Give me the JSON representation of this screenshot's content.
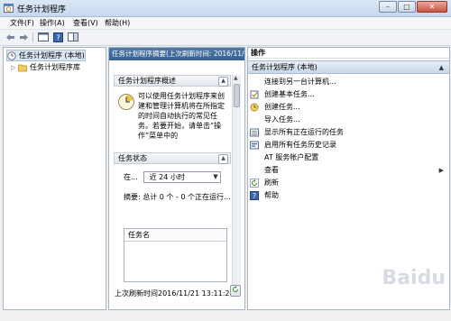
{
  "window": {
    "title": "任务计划程序",
    "controls": {
      "minimize": "–",
      "maximize": "□",
      "close": "✕"
    }
  },
  "menu": [
    "文件(F)",
    "操作(A)",
    "查看(V)",
    "帮助(H)"
  ],
  "tree": {
    "root": "任务计划程序 (本地)",
    "child": "任务计划程序库"
  },
  "middle": {
    "header": "任务计划程序摘要(上次刷新时间: 2016/11/",
    "overview": {
      "title": "任务计划程序概述",
      "text": "可以使用任务计划程序来创建和管理计算机将在所指定的时间自动执行的常见任务。若要开始，请单击“操作”菜单中的"
    },
    "status": {
      "title": "任务状态",
      "label": "在...",
      "select": "近 24 小时",
      "summary": "摘要: 总计 0 个 - 0 个正在运行..."
    },
    "table": {
      "column": "任务名"
    },
    "footer": "上次刷新时间2016/11/21 13:11:24"
  },
  "actions": {
    "title": "操作",
    "group": "任务计划程序 (本地)",
    "items": [
      {
        "label": "连接到另一台计算机...",
        "icon": "none"
      },
      {
        "label": "创建基本任务...",
        "icon": "wizard-icon"
      },
      {
        "label": "创建任务...",
        "icon": "task-icon"
      },
      {
        "label": "导入任务...",
        "icon": "none"
      },
      {
        "label": "显示所有正在运行的任务",
        "icon": "list-icon"
      },
      {
        "label": "启用所有任务历史记录",
        "icon": "history-icon"
      },
      {
        "label": "AT 服务帐户配置",
        "icon": "none"
      },
      {
        "label": "查看",
        "icon": "none",
        "submenu": true
      },
      {
        "label": "刷新",
        "icon": "refresh-icon"
      },
      {
        "label": "帮助",
        "icon": "help-icon"
      }
    ]
  },
  "watermark": "Baidu"
}
